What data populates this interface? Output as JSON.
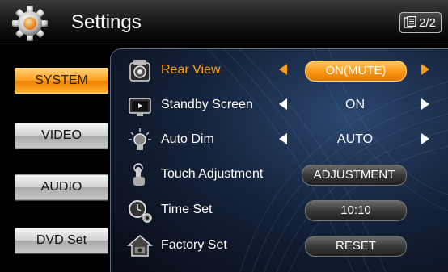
{
  "header": {
    "title": "Settings",
    "page_indicator": "2/2"
  },
  "menu": {
    "items": [
      {
        "label": "SYSTEM",
        "active": true
      },
      {
        "label": "VIDEO",
        "active": false
      },
      {
        "label": "AUDIO",
        "active": false
      },
      {
        "label": "DVD Set",
        "active": false
      }
    ]
  },
  "settings": {
    "rows": [
      {
        "label": "Rear View",
        "value": "ON(MUTE)",
        "icon": "rear-camera-icon"
      },
      {
        "label": "Standby Screen",
        "value": "ON",
        "icon": "standby-screen-icon"
      },
      {
        "label": "Auto Dim",
        "value": "AUTO",
        "icon": "bulb-icon"
      },
      {
        "label": "Touch Adjustment",
        "value": "ADJUSTMENT",
        "icon": "touch-icon"
      },
      {
        "label": "Time Set",
        "value": "10:10",
        "icon": "clock-gear-icon"
      },
      {
        "label": "Factory Set",
        "value": "RESET",
        "icon": "factory-home-icon"
      }
    ]
  },
  "colors": {
    "accent": "#ff9a1a",
    "panel": "#15233b"
  }
}
